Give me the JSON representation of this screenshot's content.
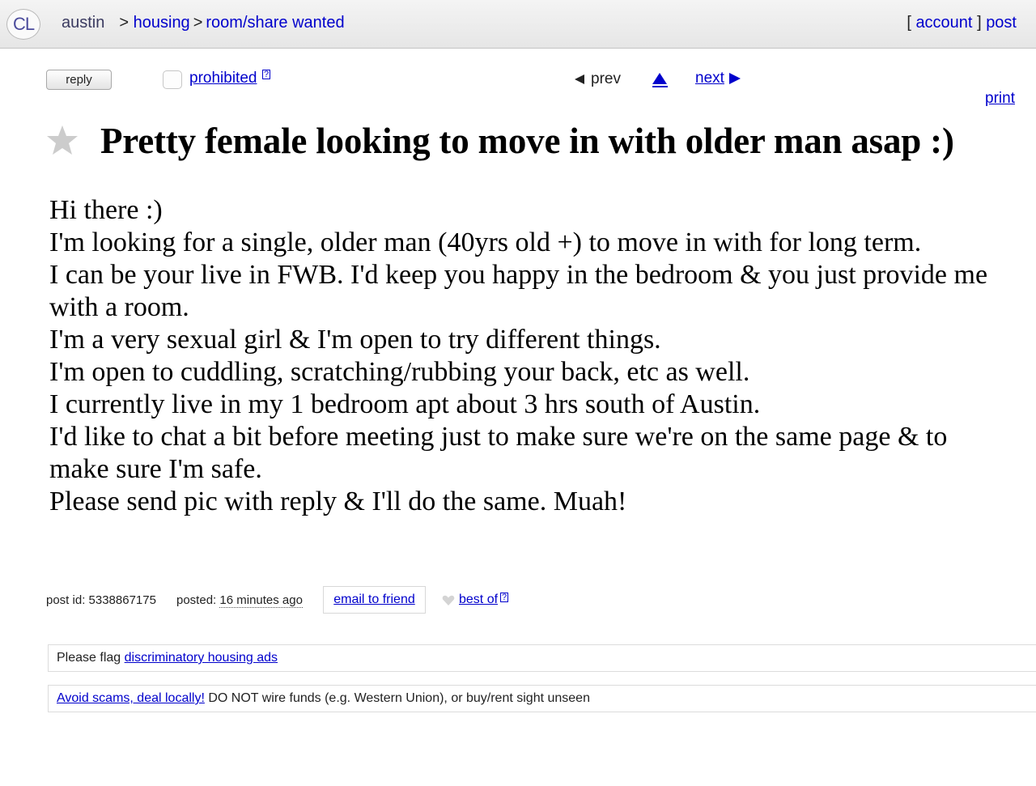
{
  "topbar": {
    "logo": "CL",
    "city": "austin",
    "breadcrumbs": [
      ">",
      "housing",
      ">",
      "room/share wanted"
    ],
    "account_open": "[",
    "account_label": "account",
    "account_close": "]",
    "post_label": "post"
  },
  "actions": {
    "reply_label": "reply",
    "prohibited_label": "prohibited",
    "help_marker": "?",
    "prev_label": "prev",
    "next_label": "next",
    "print_label": "print"
  },
  "posting": {
    "title": "Pretty female looking to move in with older man asap :)",
    "body_lines": [
      "Hi there :)",
      "I'm looking for a single, older man (40yrs old +) to move in with for long term.",
      "I can be your live in FWB. I'd keep you happy in the bedroom & you just provide me with a room.",
      "I'm a very sexual girl & I'm open to try different things.",
      "I'm open to cuddling, scratching/rubbing your back, etc as well.",
      "I currently live in my 1 bedroom apt about 3 hrs south of Austin.",
      "I'd like to chat a bit before meeting just to make sure we're on the same page & to make sure I'm safe.",
      "Please send pic with reply & I'll do the same. Muah!"
    ]
  },
  "postinfo": {
    "post_id_label": "post id: 5338867175",
    "posted_label": "posted:",
    "posted_time": "16 minutes ago",
    "email_label": "email to friend",
    "best_of_label": "best of",
    "help_marker": "?"
  },
  "notices": {
    "flag_prefix": "Please flag",
    "flag_link": "discriminatory housing ads",
    "scam_link": "Avoid scams, deal locally!",
    "scam_text": "DO NOT wire funds (e.g. Western Union), or buy/rent sight unseen"
  },
  "colors": {
    "link": "#0000cc",
    "topbar": "#ececec",
    "star": "#cccccc"
  }
}
